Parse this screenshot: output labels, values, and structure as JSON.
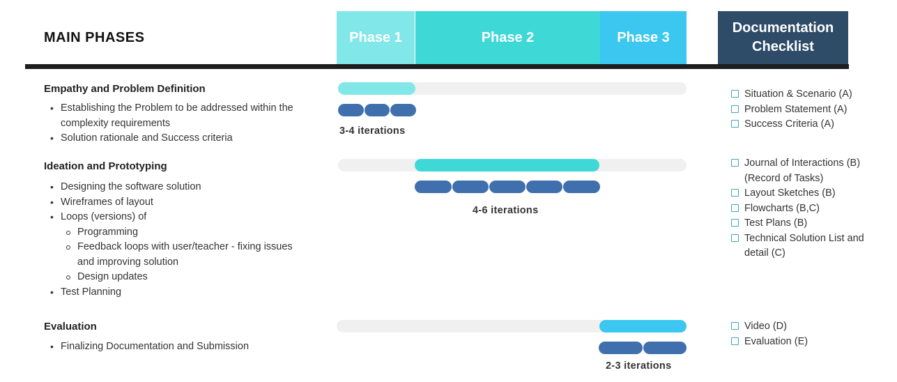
{
  "header": {
    "title": "MAIN PHASES",
    "phases": [
      "Phase 1",
      "Phase 2",
      "Phase 3"
    ],
    "doc_checklist_lines": [
      "Documentation",
      "Checklist"
    ]
  },
  "colors": {
    "phase1": "#82e7e9",
    "phase2": "#3ed8d6",
    "phase3": "#3bc7ef",
    "checklist_header": "#2e4b68",
    "iteration": "#3f70ad",
    "track": "#f0f0f0",
    "rule": "#1d1d1d"
  },
  "sections": [
    {
      "title": "Empathy and Problem Definition",
      "bullets": [
        {
          "level": 1,
          "text": "Establishing the Problem to be addressed within the complexity requirements"
        },
        {
          "level": 1,
          "text": "Solution rationale and Success criteria"
        }
      ],
      "iterations_label": "3-4 iterations",
      "checklist": [
        "Situation & Scenario (A)",
        "Problem Statement (A)",
        "Success Criteria (A)"
      ]
    },
    {
      "title": "Ideation and Prototyping",
      "bullets": [
        {
          "level": 1,
          "text": "Designing the software solution"
        },
        {
          "level": 1,
          "text": "Wireframes of layout"
        },
        {
          "level": 1,
          "text": "Loops (versions) of"
        },
        {
          "level": 2,
          "text": "Programming"
        },
        {
          "level": 2,
          "text": "Feedback loops with user/teacher - fixing issues and improving solution"
        },
        {
          "level": 2,
          "text": "Design updates"
        },
        {
          "level": 1,
          "text": "Test Planning"
        }
      ],
      "iterations_label": "4-6 iterations",
      "checklist": [
        "Journal of Interactions (B) (Record of Tasks)",
        "Layout Sketches (B)",
        "Flowcharts (B,C)",
        "Test Plans (B)",
        "Technical Solution List and detail (C)"
      ]
    },
    {
      "title": "Evaluation",
      "bullets": [
        {
          "level": 1,
          "text": "Finalizing Documentation and Submission"
        }
      ],
      "iterations_label": "2-3 iterations",
      "checklist": [
        "Video (D)",
        "Evaluation (E)"
      ]
    }
  ]
}
